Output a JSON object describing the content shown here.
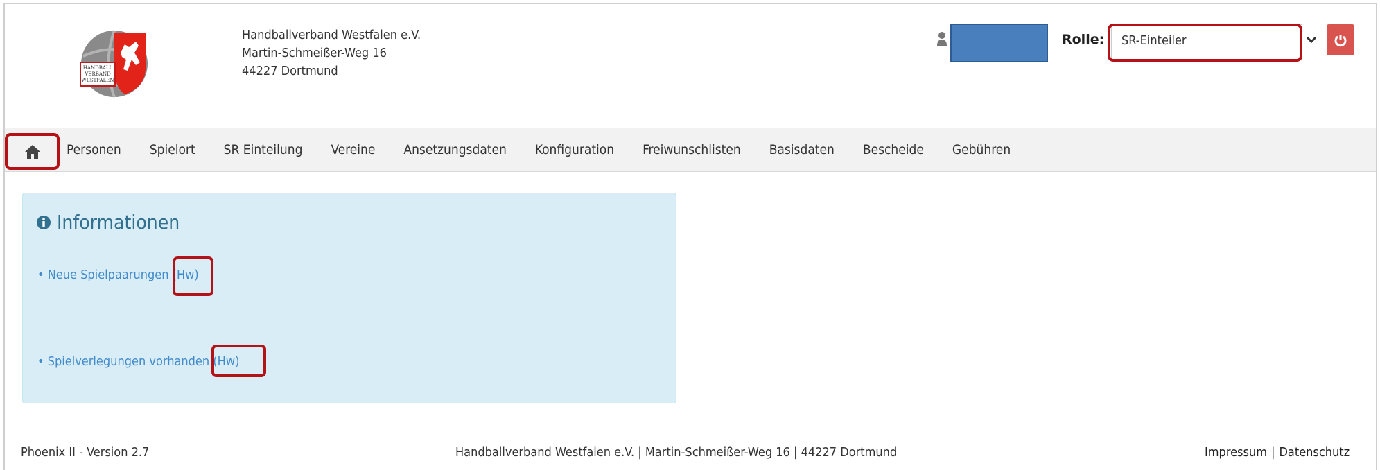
{
  "header": {
    "org_name": "Handballverband Westfalen e.V.",
    "org_street": "Martin-Schmeißer-Weg 16",
    "org_city": "44227 Dortmund",
    "logo_text": [
      "HANDBALL",
      "VERBAND",
      "WESTFALEN"
    ],
    "role_label": "Rolle:",
    "role_value": "SR-Einteiler"
  },
  "nav": {
    "items": [
      "Personen",
      "Spielort",
      "SR Einteilung",
      "Vereine",
      "Ansetzungsdaten",
      "Konfiguration",
      "Freiwunschlisten",
      "Basisdaten",
      "Bescheide",
      "Gebühren"
    ]
  },
  "info": {
    "title": "Informationen",
    "links": [
      {
        "text": "• Neue Spielpaarungen",
        "tag": "(Hw)"
      },
      {
        "text": "• Spielverlegungen vorhanden",
        "tag": "(Hw)"
      }
    ]
  },
  "footer": {
    "version": "Phoenix II - Version 2.7",
    "address": "Handballverband Westfalen e.V. | Martin-Schmeißer-Weg 16 | 44227 Dortmund",
    "impressum": "Impressum",
    "separator": "|",
    "datenschutz": "Datenschutz"
  },
  "colors": {
    "highlight_red": "#b51218",
    "nav_bg": "#f2f2f2",
    "info_bg": "#d9edf7",
    "info_text": "#31708f",
    "link": "#428bca",
    "logout_button": "#d9534f",
    "user_box": "#4a7fbd"
  },
  "icons": {
    "home": "home-icon",
    "user": "user-icon",
    "logout": "power-icon",
    "info": "info-circle-icon",
    "dropdown": "chevron-down-icon"
  }
}
